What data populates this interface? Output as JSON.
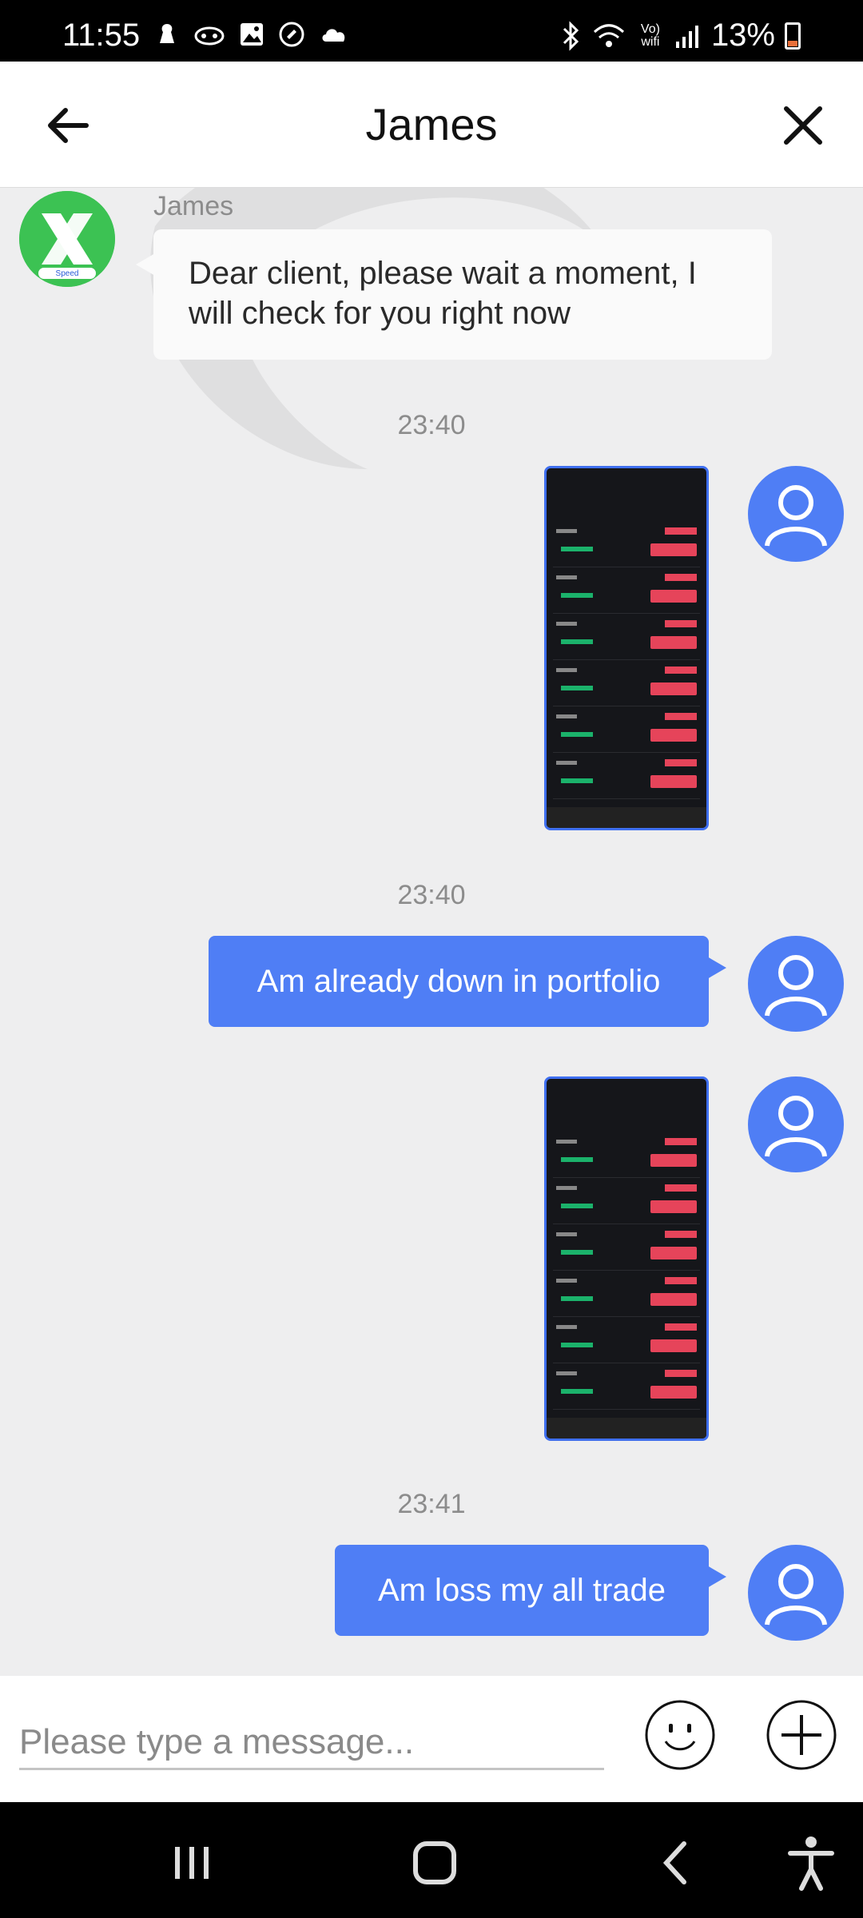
{
  "status_bar": {
    "time": "11:55",
    "battery": "13%",
    "icons_left": [
      "notification-icon",
      "game-icon",
      "image-icon",
      "call-icon",
      "cloud-icon"
    ],
    "icons_right": [
      "bluetooth-icon",
      "wifi-icon",
      "volte-icon",
      "signal-icon",
      "battery-icon"
    ],
    "volte_label": "Vo) wifi"
  },
  "header": {
    "title": "James",
    "back_icon": "arrow-left-icon",
    "close_icon": "close-icon"
  },
  "agent": {
    "name": "James",
    "avatar_badge": "Speed",
    "message": "Dear client, please wait a moment, I will check for you right now"
  },
  "messages": [
    {
      "type": "timestamp",
      "text": "23:40"
    },
    {
      "type": "image",
      "from": "user"
    },
    {
      "type": "timestamp",
      "text": "23:40"
    },
    {
      "type": "text",
      "from": "user",
      "text": "Am already down in portfolio"
    },
    {
      "type": "image",
      "from": "user"
    },
    {
      "type": "timestamp",
      "text": "23:41"
    },
    {
      "type": "text",
      "from": "user",
      "text": "Am loss my all trade"
    }
  ],
  "composer": {
    "placeholder": "Please type a message...",
    "emoji_icon": "smiley-icon",
    "plus_icon": "plus-icon"
  },
  "nav": [
    "recent-apps-icon",
    "home-icon",
    "back-icon",
    "accessibility-icon"
  ],
  "colors": {
    "accent": "#4f7ef5",
    "chat_background": "#eeeeef",
    "agent_bubble": "#fafafa",
    "agent_avatar": "#2fb84a"
  }
}
